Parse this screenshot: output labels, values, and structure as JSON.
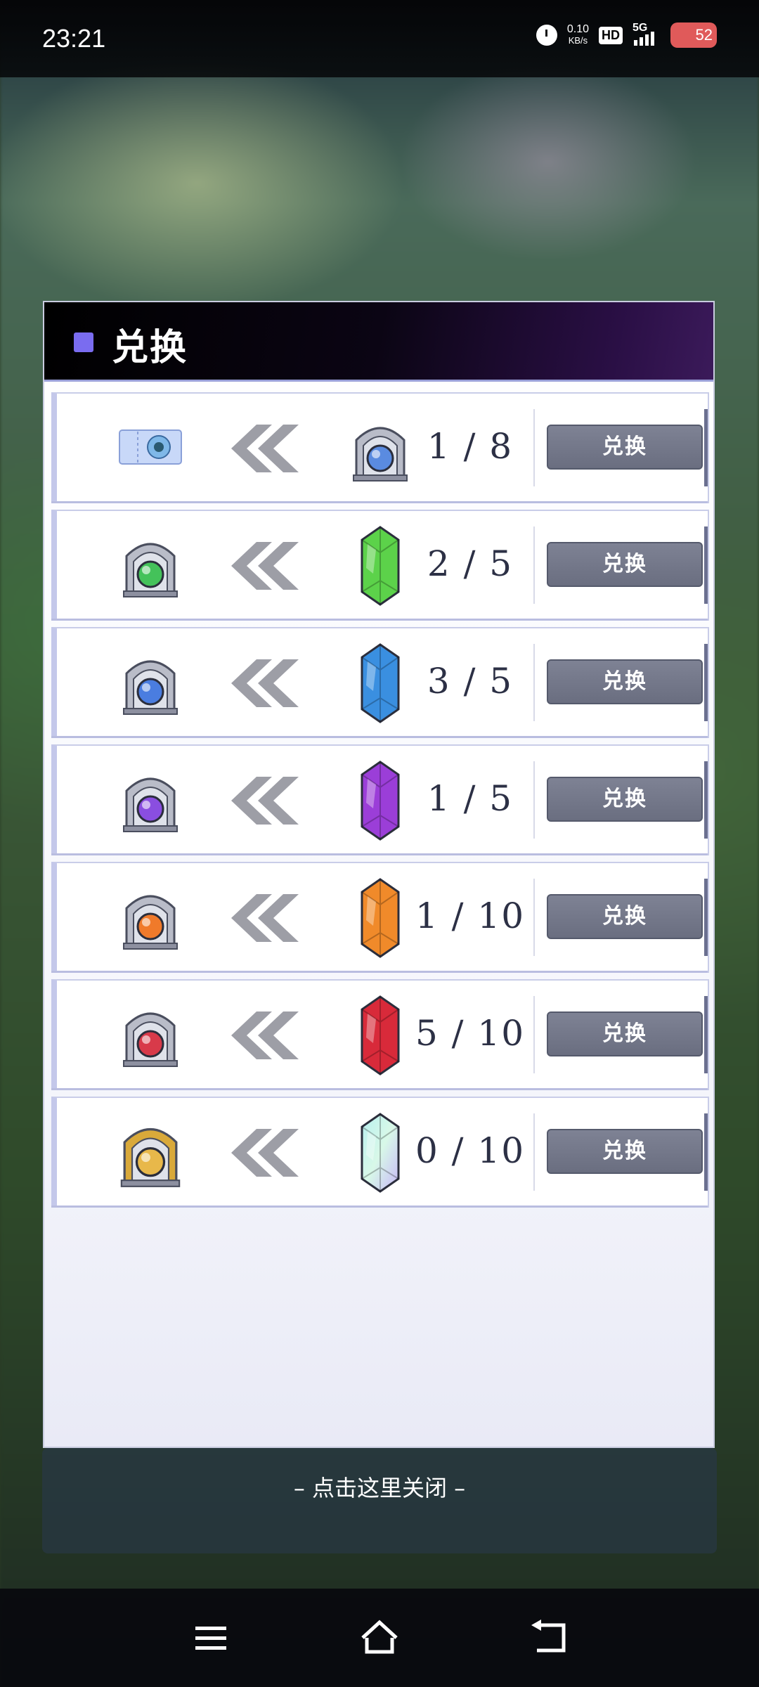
{
  "status_bar": {
    "time": "23:21",
    "net_speed_value": "0.10",
    "net_speed_unit": "KB/s",
    "hd": "HD",
    "network": "5G",
    "battery": "52",
    "icons": [
      "alarm-icon",
      "hd-icon",
      "signal-icon",
      "battery-icon"
    ]
  },
  "dialog": {
    "title": "兑换",
    "rows": [
      {
        "source_icon": "ticket-icon",
        "source_color": "#7fb8e8",
        "target_icon": "blue-gate-icon",
        "target_color": "#5a8be0",
        "count": "1 / 8",
        "button": "兑换"
      },
      {
        "source_icon": "green-gate-icon",
        "source_color": "#44c25a",
        "target_icon": "green-crystal-icon",
        "target_color": "#5cd24a",
        "count": "2 / 5",
        "button": "兑换"
      },
      {
        "source_icon": "blue-gate-icon",
        "source_color": "#4a7de0",
        "target_icon": "blue-crystal-icon",
        "target_color": "#3a8fe0",
        "count": "3 / 5",
        "button": "兑换"
      },
      {
        "source_icon": "purple-gate-icon",
        "source_color": "#8a4ee0",
        "target_icon": "purple-crystal-icon",
        "target_color": "#9b3ed8",
        "count": "1 / 5",
        "button": "兑换"
      },
      {
        "source_icon": "orange-gate-icon",
        "source_color": "#f07a2a",
        "target_icon": "orange-crystal-icon",
        "target_color": "#f08a2a",
        "count": "1 / 10",
        "button": "兑换"
      },
      {
        "source_icon": "red-gate-icon",
        "source_color": "#d83a4a",
        "target_icon": "red-crystal-icon",
        "target_color": "#d82a3a",
        "count": "5 / 10",
        "button": "兑换"
      },
      {
        "source_icon": "golden-gate-icon",
        "source_color": "#e8b84a",
        "target_icon": "rainbow-crystal-icon",
        "target_color": "#a8e8e0",
        "count": "0 / 10",
        "button": "兑换"
      }
    ]
  },
  "close_hint": "– 点击这里关闭 –",
  "nav": {
    "icons": [
      "menu-icon",
      "home-icon",
      "back-icon"
    ]
  }
}
